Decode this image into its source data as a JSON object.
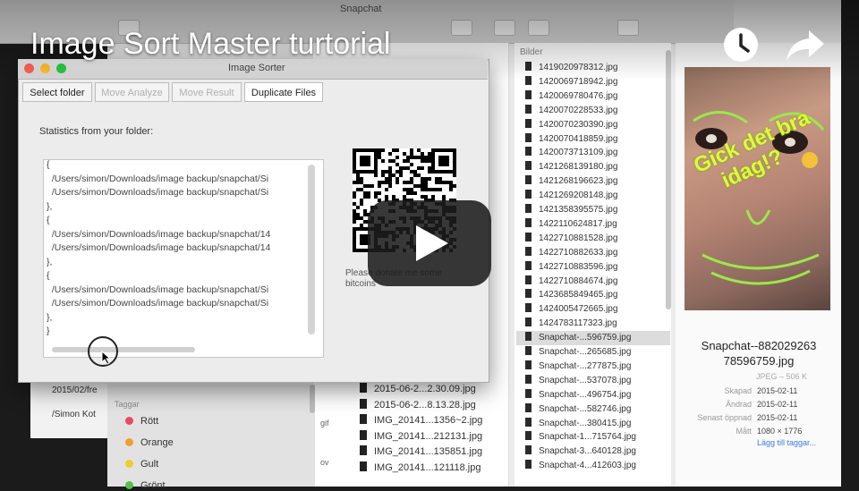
{
  "video": {
    "title": "Image Sort Master turtorial"
  },
  "finder": {
    "title": "Snapchat",
    "middle_files": [
      "2015-06-2...2.30.09.jpg",
      "2015-06-2...8.13.28.jpg",
      "IMG_20141...1356~2.jpg",
      "IMG_20141...212131.jpg",
      "IMG_20141...135851.jpg",
      "IMG_20141...121118.jpg"
    ],
    "list_header": "Bilder",
    "files": [
      "1419020978312.jpg",
      "1420069718942.jpg",
      "1420069780476.jpg",
      "1420070228533.jpg",
      "1420070230390.jpg",
      "1420070418859.jpg",
      "1420073713109.jpg",
      "1421268139180.jpg",
      "1421268196623.jpg",
      "1421269208148.jpg",
      "1421358395575.jpg",
      "1422110624817.jpg",
      "1422710881528.jpg",
      "1422710882633.jpg",
      "1422710883596.jpg",
      "1422710884674.jpg",
      "1423685849465.jpg",
      "1424005472665.jpg",
      "1424783117323.jpg",
      "Snapchat-...596759.jpg",
      "Snapchat-...265685.jpg",
      "Snapchat-...277875.jpg",
      "Snapchat-...537078.jpg",
      "Snapchat-...496754.jpg",
      "Snapchat-...582746.jpg",
      "Snapchat-...380415.jpg",
      "Snapchat-1...715764.jpg",
      "Snapchat-3...640128.jpg",
      "Snapchat-4...412603.jpg"
    ],
    "selected_index": 19,
    "preview": {
      "overlay_line1": "Gick det bra",
      "overlay_line2": "idag!?",
      "name": "Snapchat--882029263 78596759.jpg",
      "kind": "JPEG – 506 K",
      "meta": [
        {
          "k": "Skapad",
          "v": "2015-02-11"
        },
        {
          "k": "Ändrad",
          "v": "2015-02-11"
        },
        {
          "k": "Senast öppnad",
          "v": "2015-02-11"
        },
        {
          "k": "Mått",
          "v": "1080 × 1776"
        }
      ],
      "add_tags": "Lägg till taggar..."
    },
    "under_date": "2015/02/fre",
    "under_name": "/Simon Kot",
    "tags_header": "Taggar",
    "tags": [
      {
        "name": "Rött",
        "color": "#e84a5f"
      },
      {
        "name": "Orange",
        "color": "#f0a030"
      },
      {
        "name": "Gult",
        "color": "#f0cc30"
      },
      {
        "name": "Grönt",
        "color": "#55c14a"
      }
    ],
    "tag_side": [
      "gif",
      "ov"
    ]
  },
  "app": {
    "title": "Image Sorter",
    "tabs": [
      {
        "label": "Select folder",
        "state": "normal"
      },
      {
        "label": "Move Analyze",
        "state": "disabled"
      },
      {
        "label": "Move Result",
        "state": "disabled"
      },
      {
        "label": "Duplicate Files",
        "state": "active"
      }
    ],
    "stats_label": "Statistics from your folder:",
    "code_lines": [
      "{",
      "  /Users/simon/Downloads/image backup/snapchat/Si",
      "  /Users/simon/Downloads/image backup/snapchat/Si",
      "},",
      "{",
      "  /Users/simon/Downloads/image backup/snapchat/14",
      "  /Users/simon/Downloads/image backup/snapchat/14",
      "},",
      "{",
      "  /Users/simon/Downloads/image backup/snapchat/Si",
      "  /Users/simon/Downloads/image backup/snapchat/Si",
      "},",
      "}"
    ],
    "donate_text": "Please donate me some bitcoins"
  },
  "colors": {
    "play_bg": "#1c1c1c",
    "overlay_text": "#d9ff3a",
    "link": "#3b7be0"
  }
}
